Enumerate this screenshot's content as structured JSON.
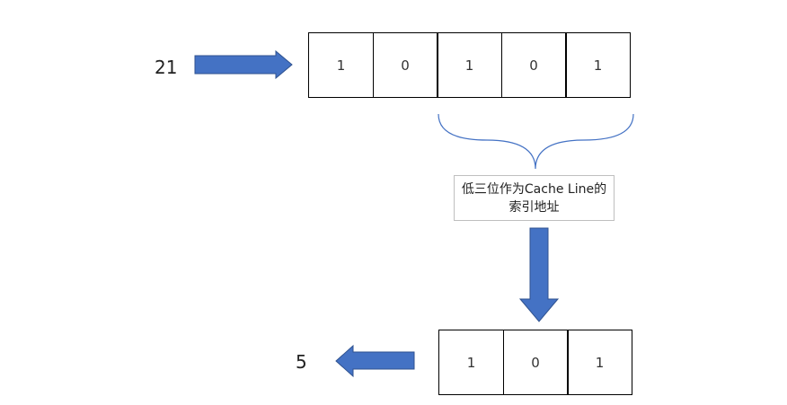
{
  "input": {
    "value": "21",
    "bits": [
      "1",
      "0",
      "1",
      "0",
      "1"
    ]
  },
  "note": {
    "line1": "低三位作为Cache Line的",
    "line2": "索引地址"
  },
  "output": {
    "value": "5",
    "bits": [
      "1",
      "0",
      "1"
    ]
  },
  "colors": {
    "arrow_fill": "#4472c4",
    "arrow_stroke": "#2f528f",
    "brace": "#4472c4"
  },
  "icons": [
    "right-arrow-icon",
    "down-arrow-icon",
    "left-arrow-icon",
    "curly-brace-icon"
  ]
}
